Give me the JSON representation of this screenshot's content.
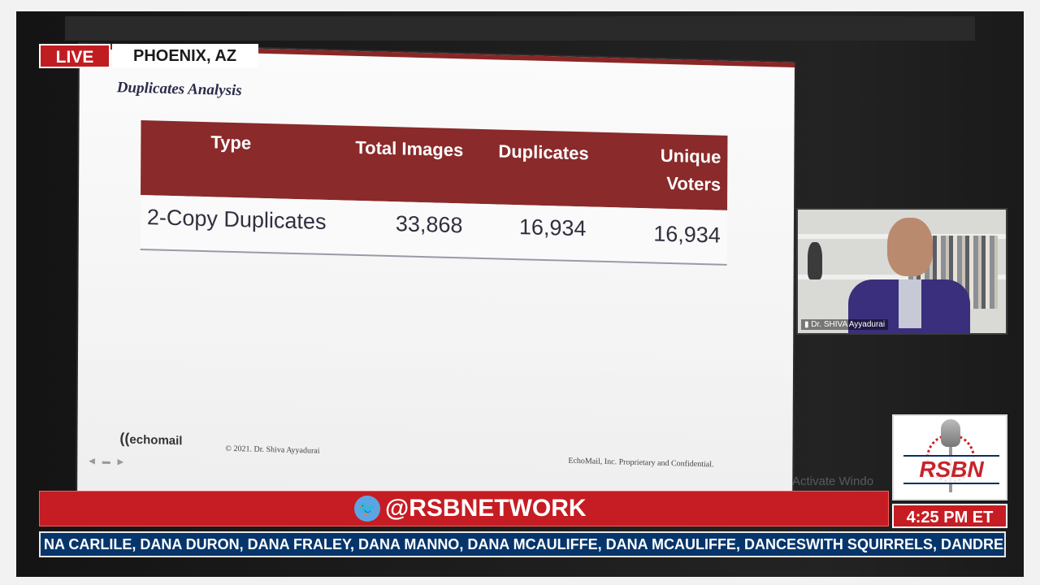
{
  "overlay": {
    "live_label": "LIVE",
    "location": "PHOENIX, AZ",
    "handle": "@RSBNETWORK",
    "time": "4:25 PM ET",
    "logo_text": "RSBN",
    "ticker_text": "NA CARLILE, DANA DURON, DANA FRALEY, DANA MANNO, DANA MCAULIFFE, DANA MCAULIFFE, DANCESWITH SQUIRRELS, DANDREADD, D"
  },
  "slide": {
    "title": "Duplicates Analysis",
    "table": {
      "headers": [
        "Type",
        "Total Images",
        "Duplicates",
        "Unique Voters"
      ],
      "rows": [
        [
          "2-Copy Duplicates",
          "33,868",
          "16,934",
          "16,934"
        ]
      ]
    },
    "footer_logo": "echomail",
    "copyright": "© 2021. Dr. Shiva Ayyadurai",
    "confidential": "EchoMail, Inc. Proprietary and Confidential."
  },
  "watermark": "Activate Windo",
  "pip": {
    "name_label": "Dr. SHIVA Ayyadurai"
  },
  "colors": {
    "live_red": "#c01d22",
    "header_maroon": "#8a2a2a",
    "ticker_blue": "#06356b"
  }
}
